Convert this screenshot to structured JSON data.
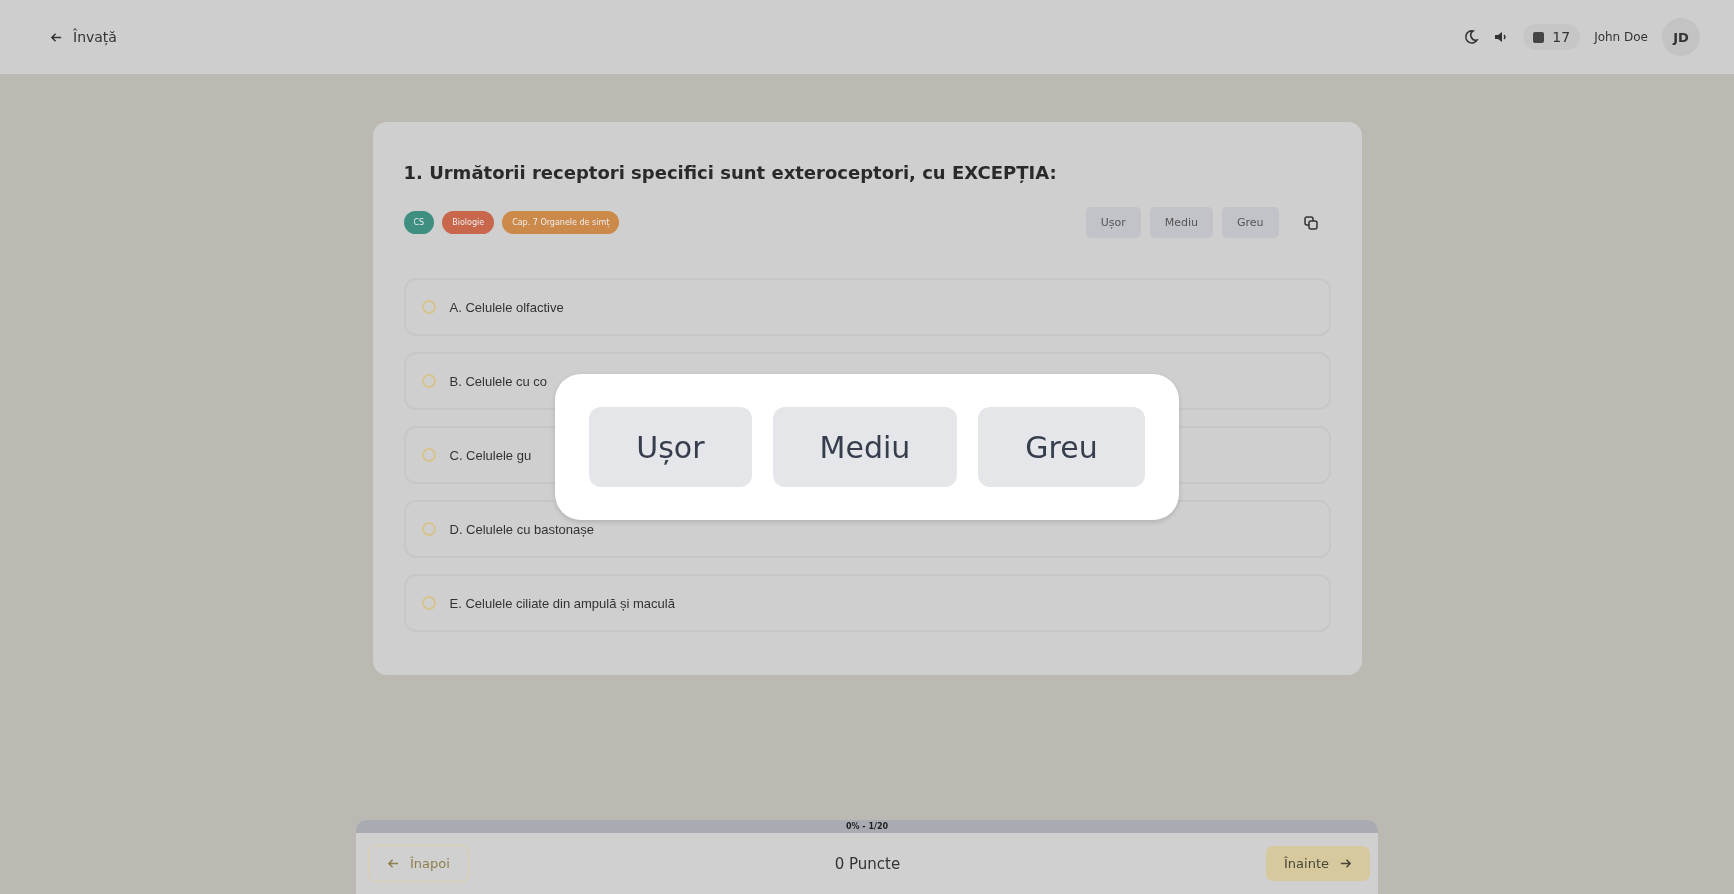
{
  "header": {
    "back_link": "Învață",
    "counter": "17",
    "user_name": "John Doe",
    "avatar": "JD"
  },
  "question": {
    "title": "1. Următorii receptori specifici sunt exteroceptori, cu EXCEPȚIA:",
    "tags": [
      {
        "label": "CS",
        "color": "#3f8f80"
      },
      {
        "label": "Biologie",
        "color": "#c8674c"
      },
      {
        "label": "Cap. 7 Organele de simț",
        "color": "#cc8a4a"
      }
    ],
    "difficulty_buttons": [
      "Ușor",
      "Mediu",
      "Greu"
    ],
    "options": [
      {
        "label": "A. Celulele olfactive",
        "selected": false
      },
      {
        "label": "B. Celulele cu co",
        "selected": false
      },
      {
        "label": "C. Celulele gu",
        "selected": false
      },
      {
        "label": "D. Celulele cu bastonașe",
        "selected": false
      },
      {
        "label": "E. Celulele ciliate din ampulă și maculă",
        "selected": false
      }
    ]
  },
  "progress": {
    "label": "0% - 1/20",
    "level": 0
  },
  "footer": {
    "back_button": {
      "label": "Înapoi",
      "disabled": true
    },
    "points": "0 Puncte",
    "next_button": {
      "label": "Înainte",
      "disabled": false
    }
  },
  "modal": {
    "buttons": [
      "Ușor",
      "Mediu",
      "Greu"
    ]
  }
}
